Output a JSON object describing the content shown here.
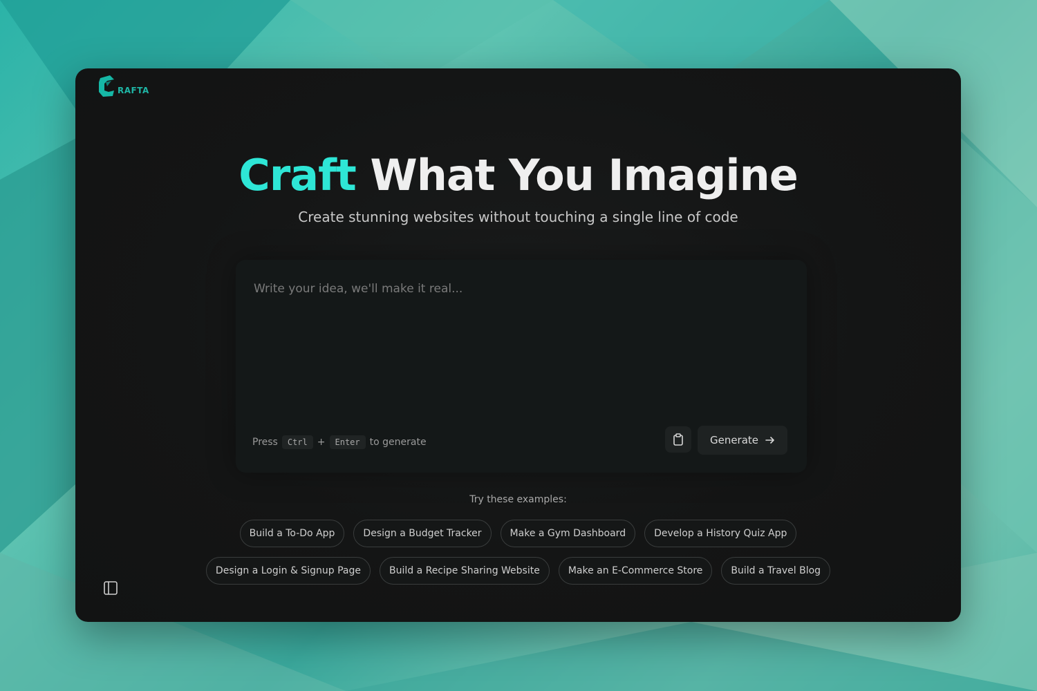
{
  "app": {
    "logo_text": "RAFTA"
  },
  "hero": {
    "title_accent": "Craft",
    "title_rest": " What You Imagine",
    "subtitle": "Create stunning websites without touching a single line of code"
  },
  "prompt": {
    "placeholder": "Write your idea, we'll make it real...",
    "value": "",
    "hint_press": "Press",
    "key_ctrl": "Ctrl",
    "plus": "+",
    "key_enter": "Enter",
    "hint_suffix": "to generate",
    "generate_label": "Generate"
  },
  "examples": {
    "label": "Try these examples:",
    "row1": [
      "Build a To-Do App",
      "Design a Budget Tracker",
      "Make a Gym Dashboard",
      "Develop a History Quiz App"
    ],
    "row2": [
      "Design a Login & Signup Page",
      "Build a Recipe Sharing Website",
      "Make an E-Commerce Store",
      "Build a Travel Blog"
    ]
  },
  "colors": {
    "accent": "#2ee6d6",
    "window_bg": "#141515",
    "background_teal": "#3aa89c"
  },
  "icons": {
    "clipboard": "clipboard-icon",
    "generate_arrow": "arrow-right-icon",
    "sidebar": "sidebar-toggle-icon",
    "logo": "crafta-logo-icon"
  }
}
